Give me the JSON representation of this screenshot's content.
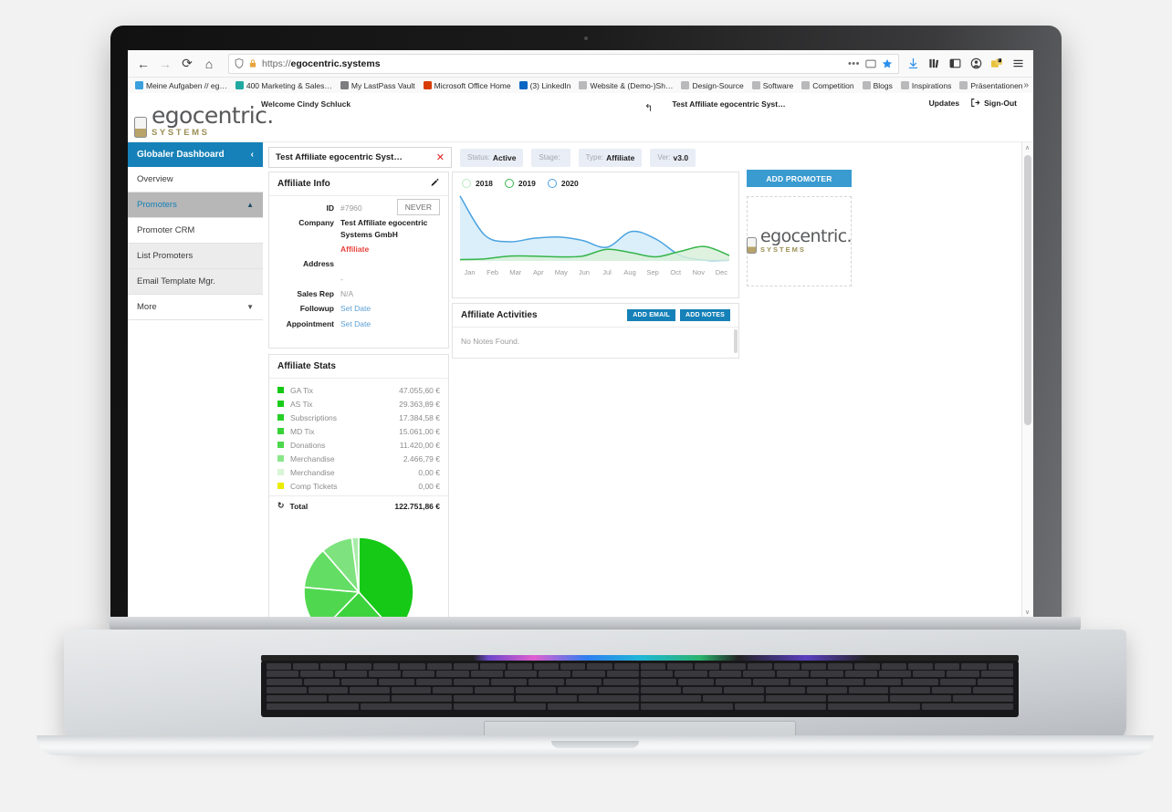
{
  "device": {
    "label": "MacBook Pro"
  },
  "browser": {
    "back_icon": "back-arrow-icon",
    "forward_icon": "forward-arrow-icon",
    "reload_icon": "reload-icon",
    "home_icon": "home-icon",
    "url_prefix": "https://",
    "url_domain": "egocentric.systems",
    "overflow_dots": "•••",
    "bookmarks": [
      {
        "label": "Meine Aufgaben // eg…",
        "color": "#3aa0dd"
      },
      {
        "label": "400 Marketing & Sales…",
        "color": "#1fa9a0"
      },
      {
        "label": "My LastPass Vault",
        "color": "#7d7d80"
      },
      {
        "label": "Microsoft Office Home",
        "color": "#d83b01"
      },
      {
        "label": "(3) LinkedIn",
        "color": "#0a66c2"
      },
      {
        "label": "Website & (Demo-)Sh…",
        "color": "#b9b9bc"
      },
      {
        "label": "Design-Source",
        "color": "#b9b9bc"
      },
      {
        "label": "Software",
        "color": "#b9b9bc"
      },
      {
        "label": "Competition",
        "color": "#b9b9bc"
      },
      {
        "label": "Blogs",
        "color": "#b9b9bc"
      },
      {
        "label": "Inspirations",
        "color": "#b9b9bc"
      },
      {
        "label": "Präsentationen",
        "color": "#b9b9bc"
      }
    ],
    "bookmarks_overflow": "»"
  },
  "app": {
    "logo": {
      "name": "egocentric.",
      "sub": "SYSTEMS"
    },
    "welcome_prefix": "Welcome",
    "welcome_user": "Cindy Schluck",
    "header_title": "Test Affiliate egocentric Syst…",
    "updates_label": "Updates",
    "signout_label": "Sign-Out"
  },
  "sidebar": {
    "header": "Globaler Dashboard",
    "header_caret": "‹",
    "items": [
      {
        "label": "Overview",
        "caret": ""
      },
      {
        "label": "Promoters",
        "caret": "▲"
      },
      {
        "label": "Promoter CRM",
        "caret": ""
      },
      {
        "label": "List Promoters",
        "caret": ""
      },
      {
        "label": "Email Template Mgr.",
        "caret": ""
      },
      {
        "label": "More",
        "caret": "▼"
      }
    ]
  },
  "tabs": {
    "main_tab": "Test Affiliate egocentric Syst…",
    "close_icon": "✕",
    "pills": [
      {
        "label": "Status:",
        "value": "Active"
      },
      {
        "label": "Stage:",
        "value": ""
      },
      {
        "label": "Type:",
        "value": "Affiliate"
      },
      {
        "label": "Ver:",
        "value": "v3.0"
      }
    ]
  },
  "affiliate_info": {
    "title": "Affiliate Info",
    "edit_icon": "pencil-icon",
    "never_label": "NEVER",
    "rows": [
      {
        "label": "ID",
        "value": "#7960",
        "style": ""
      },
      {
        "label": "Company",
        "value": "Test Affiliate egocentric Systems GmbH",
        "style": "strong"
      },
      {
        "label": "",
        "value": "Affiliate",
        "style": "red"
      },
      {
        "label": "Address",
        "value": "",
        "style": ""
      },
      {
        "label": "",
        "value": "-",
        "style": ""
      },
      {
        "label": "Sales Rep",
        "value": "N/A",
        "style": ""
      },
      {
        "label": "Followup",
        "value": "Set Date",
        "style": "link"
      },
      {
        "label": "Appointment",
        "value": "Set Date",
        "style": "link"
      }
    ]
  },
  "affiliate_stats": {
    "title": "Affiliate Stats",
    "refresh_icon": "refresh-icon",
    "rows": [
      {
        "label": "GA Tix",
        "value": "47.055,60 €",
        "color": "#14c814"
      },
      {
        "label": "AS Tix",
        "value": "29.363,89 €",
        "color": "#19cc19"
      },
      {
        "label": "Subscriptions",
        "value": "17.384,58 €",
        "color": "#27cf27"
      },
      {
        "label": "MD Tix",
        "value": "15.061,00 €",
        "color": "#36d236"
      },
      {
        "label": "Donations",
        "value": "11.420,00 €",
        "color": "#4cd84c"
      },
      {
        "label": "Merchandise",
        "value": "2.466,79 €",
        "color": "#8ae68a"
      },
      {
        "label": "Merchandise",
        "value": "0,00 €",
        "color": "#d8f5d8"
      },
      {
        "label": "Comp Tickets",
        "value": "0,00 €",
        "color": "#ecec00"
      }
    ],
    "total_label": "Total",
    "total_value": "122.751,86 €"
  },
  "activities": {
    "title": "Affiliate Activities",
    "add_email_label": "ADD EMAIL",
    "add_notes_label": "ADD NOTES",
    "empty_text": "No Notes Found."
  },
  "right_panel": {
    "add_promoter_label": "ADD PROMOTER",
    "logo_name": "egocentric.",
    "logo_sub": "SYSTEMS"
  },
  "chart_data": {
    "type": "area",
    "title": "",
    "xlabel": "",
    "ylabel": "",
    "grid": false,
    "legend_position": "top-left",
    "categories": [
      "Jan",
      "Feb",
      "Mar",
      "Apr",
      "May",
      "Jun",
      "Jul",
      "Aug",
      "Sep",
      "Oct",
      "Nov",
      "Dec"
    ],
    "ylim": [
      0,
      100
    ],
    "series": [
      {
        "name": "2018",
        "color": "#b9ecc0",
        "values": [
          0,
          0,
          0,
          0,
          0,
          0,
          0,
          0,
          0,
          0,
          0,
          0
        ]
      },
      {
        "name": "2019",
        "color": "#35b54a",
        "values": [
          2,
          3,
          7,
          7,
          6,
          7,
          17,
          12,
          6,
          14,
          21,
          8
        ]
      },
      {
        "name": "2020",
        "color": "#4aa3e0",
        "values": [
          95,
          38,
          28,
          33,
          35,
          30,
          20,
          43,
          32,
          8,
          1,
          1
        ]
      }
    ]
  },
  "pie_chart": {
    "type": "pie",
    "slices": [
      {
        "label": "GA Tix",
        "value": 47055.6,
        "color": "#16c916"
      },
      {
        "label": "AS Tix",
        "value": 29363.89,
        "color": "#3cd33c"
      },
      {
        "label": "Subscriptions",
        "value": 17384.58,
        "color": "#4fd84f"
      },
      {
        "label": "MD Tix",
        "value": 15061.0,
        "color": "#63dd63"
      },
      {
        "label": "Donations",
        "value": 11420.0,
        "color": "#7ee37e"
      },
      {
        "label": "Merchandise",
        "value": 2466.79,
        "color": "#a9eca9"
      }
    ]
  },
  "scrollbar": {
    "up": "∧",
    "down": "∨"
  }
}
